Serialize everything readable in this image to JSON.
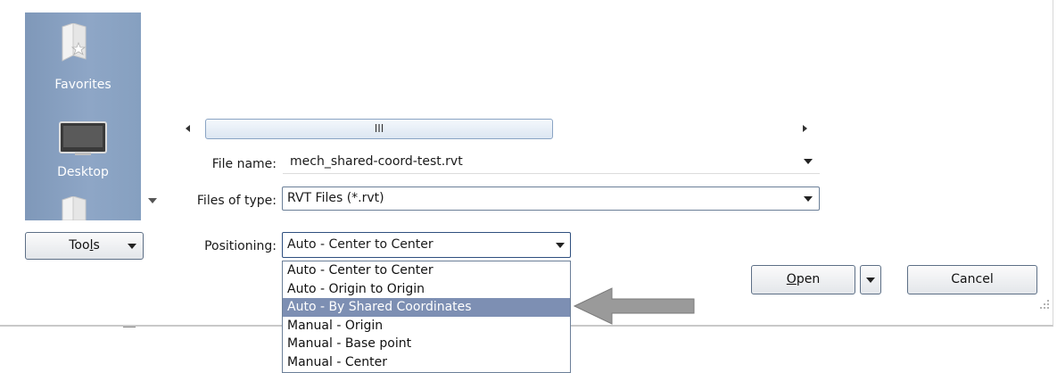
{
  "sidebar": {
    "items": [
      {
        "label": "Favorites",
        "icon": "favorites-folder-icon"
      },
      {
        "label": "Desktop",
        "icon": "desktop-icon"
      },
      {
        "label": "",
        "icon": "folder-icon"
      }
    ]
  },
  "scrollbar": {
    "thumb_glyph": "III"
  },
  "file_name": {
    "label": "File name:",
    "value": "mech_shared-coord-test.rvt"
  },
  "file_type": {
    "label": "Files of type:",
    "value": "RVT Files  (*.rvt)"
  },
  "positioning": {
    "label": "Positioning:",
    "value": "Auto - Center to Center",
    "options": [
      "Auto - Center to Center",
      "Auto - Origin to Origin",
      "Auto - By Shared Coordinates",
      "Manual - Origin",
      "Manual - Base point",
      "Manual - Center"
    ],
    "highlighted_index": 2
  },
  "buttons": {
    "tools": {
      "pre": "Too",
      "mnemonic": "l",
      "post": "s"
    },
    "open": {
      "mnemonic": "O",
      "post": "pen"
    },
    "cancel": "Cancel"
  },
  "colors": {
    "sidebar": "#8ea6c6",
    "highlight": "#7d8fb3",
    "annotation_arrow": "#9a9a9a"
  }
}
